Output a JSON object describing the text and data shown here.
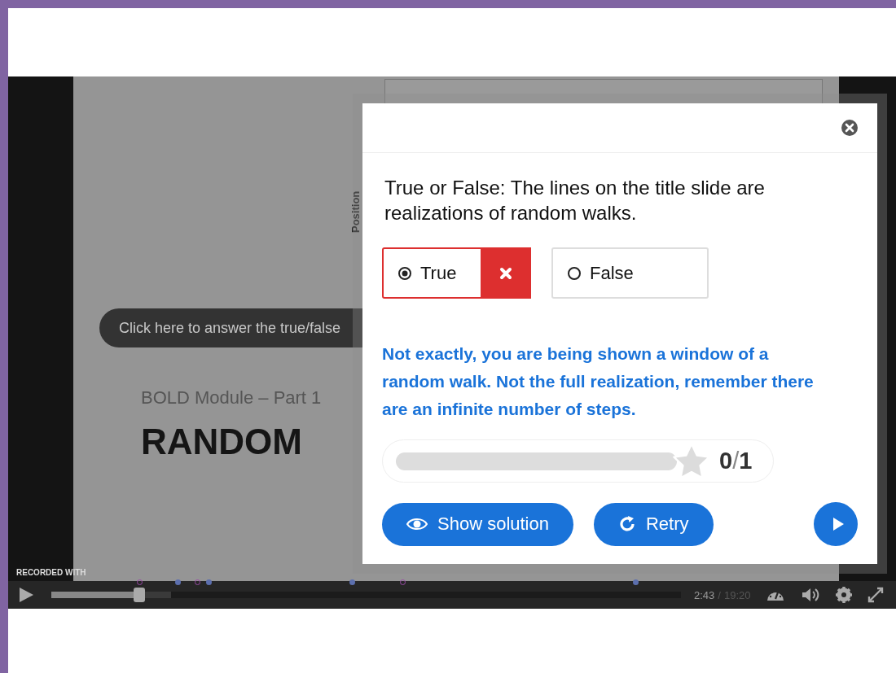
{
  "video": {
    "slide": {
      "axis_label": "Position",
      "subtitle": "BOLD Module – Part 1",
      "title": "RANDOM"
    },
    "tooltip": "Click here to answer the true/false",
    "recorder_label": "RECORDED WITH",
    "controls": {
      "playing": false,
      "progress": {
        "level": 0.14
      },
      "buffer": {
        "level": 0.19
      },
      "current_time": "2:43",
      "separator": "/",
      "duration": "19:20"
    }
  },
  "dialog": {
    "question": "True or False: The lines on the title slide are realizations of random walks.",
    "options": [
      {
        "label": "True",
        "selected": true,
        "wrong": true
      },
      {
        "label": "False",
        "selected": false,
        "wrong": false
      }
    ],
    "feedback": "Not exactly, you are being shown a window of a random walk. Not the full realization, remember there are an infinite number of steps.",
    "score": {
      "level": 0,
      "score": "0",
      "separator": "/",
      "max": "1"
    },
    "buttons": [
      {
        "kind": "show_solution",
        "label": "Show solution"
      },
      {
        "kind": "retry",
        "label": "Retry"
      }
    ]
  }
}
